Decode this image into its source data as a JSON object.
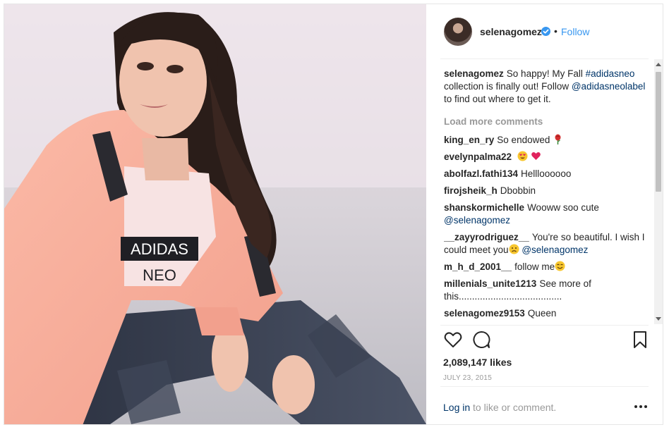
{
  "post": {
    "username": "selenagomez",
    "separator": "•",
    "follow_label": "Follow",
    "caption": {
      "user": "selenagomez",
      "text_1": "So happy! My Fall",
      "hashtag": "#adidasneo",
      "text_2": "collection is finally out! Follow",
      "mention": "@adidasneolabel",
      "text_3": "to find out where to get it."
    },
    "load_more": "Load more comments",
    "comments": [
      {
        "user": "king_en_ry",
        "text": "So endowed",
        "emoji": "rose"
      },
      {
        "user": "evelynpalma22",
        "text": "",
        "emoji": "heart-eyes-and-heart"
      },
      {
        "user": "abolfazl.fathi134",
        "text": "Hellloooooo"
      },
      {
        "user": "firojsheik_h",
        "text": "Dbobbin"
      },
      {
        "user": "shanskormichelle",
        "text": "Wooww soo cute",
        "mention": "@selenagomez"
      },
      {
        "user": "__zayyrodriguez__",
        "text": "You're so beautiful. I wish I could meet you",
        "emoji": "sad-face",
        "mention": "@selenagomez"
      },
      {
        "user": "m_h_d_2001__",
        "text": "follow me",
        "emoji": "smile"
      },
      {
        "user": "millenials_unite1213",
        "text": "See more of this......................................."
      },
      {
        "user": "selenagomez9153",
        "text": "Queen"
      }
    ],
    "likes": "2,089,147 likes",
    "date": "JULY 23, 2015",
    "login": {
      "link": "Log in",
      "text": "to like or comment."
    },
    "photo_print": {
      "line1": "ADIDAS",
      "line2": "NEO"
    },
    "colors": {
      "link_blue": "#3897f0",
      "mention_blue": "#003569",
      "muted": "#999999",
      "verified_blue": "#3897f0"
    }
  }
}
